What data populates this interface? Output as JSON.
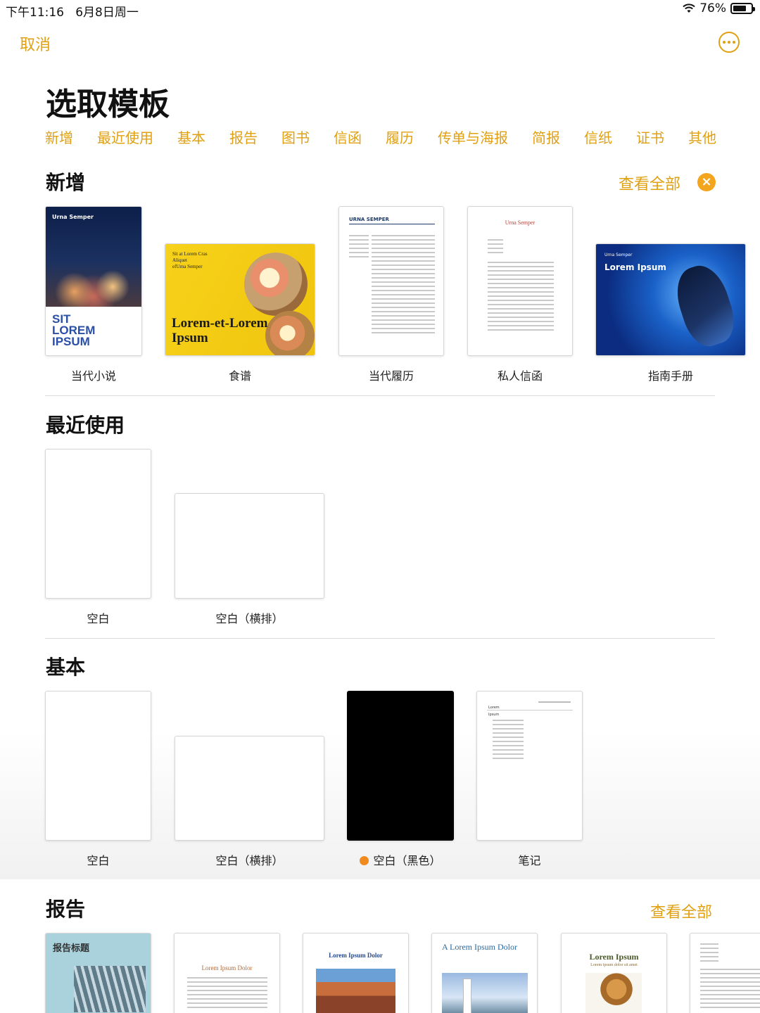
{
  "status": {
    "time": "下午11:16",
    "date": "6月8日周一",
    "battery_pct": "76%",
    "battery_level": 0.76
  },
  "nav": {
    "cancel_label": "取消",
    "more_icon": "ellipsis-circle-icon"
  },
  "title": "选取模板",
  "categories": [
    "新增",
    "最近使用",
    "基本",
    "报告",
    "图书",
    "信函",
    "履历",
    "传单与海报",
    "简报",
    "信纸",
    "证书",
    "其他"
  ],
  "sections": {
    "new": {
      "title": "新增",
      "see_all": "查看全部",
      "close_icon": "×",
      "templates": [
        {
          "label": "当代小说",
          "cover_name": "Urna Semper",
          "cover_text": [
            "SIT",
            "LOREM",
            "IPSUM"
          ]
        },
        {
          "label": "食谱",
          "small_text": [
            "Sit at Lorem Cras",
            "Aliquet",
            "efUrna Semper"
          ],
          "big_text": [
            "Lorem-et-Lorem",
            "Ipsum"
          ]
        },
        {
          "label": "当代履历",
          "header": "URNA SEMPER"
        },
        {
          "label": "私人信函",
          "header": "Urna Semper"
        },
        {
          "label": "指南手册",
          "small_text": "Urna Semper",
          "big_text": "Lorem Ipsum"
        }
      ]
    },
    "recent": {
      "title": "最近使用",
      "templates": [
        {
          "label": "空白"
        },
        {
          "label": "空白（横排）"
        }
      ]
    },
    "basic": {
      "title": "基本",
      "templates": [
        {
          "label": "空白"
        },
        {
          "label": "空白（横排）"
        },
        {
          "label": "空白（黑色）"
        },
        {
          "label": "笔记",
          "note_title": "Lorem",
          "note_sub": "Ipsum"
        }
      ]
    },
    "reports": {
      "title": "报告",
      "see_all": "查看全部",
      "templates": [
        {
          "cover_title": "报告标题"
        },
        {
          "cover_title": "Lorem Ipsum Dolor"
        },
        {
          "cover_title": "Lorem Ipsum Dolor"
        },
        {
          "cover_title": "A Lorem Ipsum Dolor"
        },
        {
          "cover_title": "Lorem Ipsum",
          "cover_sub": "Lorem ipsum dolor sit amet"
        },
        {
          "cover_title": ""
        }
      ]
    }
  }
}
